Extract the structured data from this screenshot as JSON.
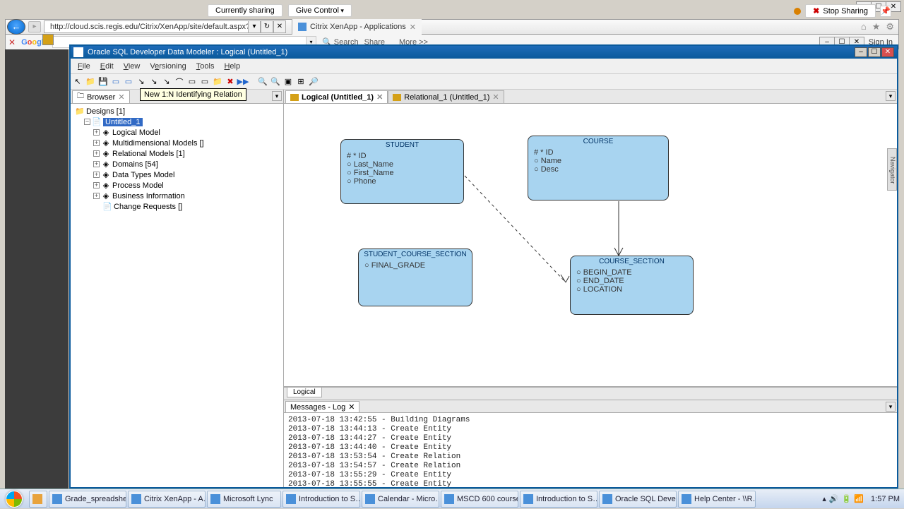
{
  "sharing": {
    "status": "Currently sharing",
    "give": "Give Control",
    "stop": "Stop Sharing"
  },
  "outer_winctrls": {
    "min": "–",
    "max": "☐",
    "close": "✕"
  },
  "browser": {
    "url": "http://cloud.scis.regis.edu/Citrix/XenApp/site/default.aspx?CTX_C",
    "tab": "Citrix XenApp - Applications"
  },
  "google": {
    "search": "Search",
    "share": "Share",
    "more": "More >>",
    "signin": "Sign In"
  },
  "oracle": {
    "title": "Oracle SQL Developer Data Modeler : Logical (Untitled_1)",
    "menu": [
      "File",
      "Edit",
      "View",
      "Versioning",
      "Tools",
      "Help"
    ],
    "tooltip": "New 1:N Identifying Relation",
    "browser_tab": "Browser",
    "tree": {
      "designs": "Designs [1]",
      "untitled": "Untitled_1",
      "items": [
        "Logical Model",
        "Multidimensional Models []",
        "Relational Models [1]",
        "Domains [54]",
        "Data Types Model",
        "Process Model",
        "Business Information",
        "Change Requests []"
      ]
    },
    "canvas_tabs": {
      "logical": "Logical (Untitled_1)",
      "relational": "Relational_1 (Untitled_1)"
    },
    "entities": {
      "student": {
        "name": "STUDENT",
        "attrs": [
          "# * ID",
          "○ Last_Name",
          "○ First_Name",
          "○ Phone"
        ]
      },
      "course": {
        "name": "COURSE",
        "attrs": [
          "# * ID",
          "○ Name",
          "○ Desc"
        ]
      },
      "scs": {
        "name": "STUDENT_COURSE_SECTION",
        "attrs": [
          "○ FINAL_GRADE"
        ]
      },
      "cs": {
        "name": "COURSE_SECTION",
        "attrs": [
          "○ BEGIN_DATE",
          "○ END_DATE",
          "○ LOCATION"
        ]
      }
    },
    "bottom_tab": "Logical",
    "messages_tab": "Messages - Log",
    "log": [
      "2013-07-18 13:42:55 - Building Diagrams",
      "2013-07-18 13:44:13 - Create Entity",
      "2013-07-18 13:44:27 - Create Entity",
      "2013-07-18 13:44:40 - Create Entity",
      "2013-07-18 13:53:54 - Create Relation",
      "2013-07-18 13:54:57 - Create Relation",
      "2013-07-18 13:55:29 - Create Entity",
      "2013-07-18 13:55:55 - Create Entity"
    ],
    "nav": "Navigator"
  },
  "taskbar": {
    "items": [
      "Grade_spreadshe…",
      "Citrix XenApp - A…",
      "Microsoft Lync",
      "Introduction to S…",
      "Calendar - Micro…",
      "MSCD 600 course…",
      "Introduction to S…",
      "Oracle SQL Devel…",
      "Help Center - \\\\R…"
    ],
    "clock": "1:57 PM"
  }
}
